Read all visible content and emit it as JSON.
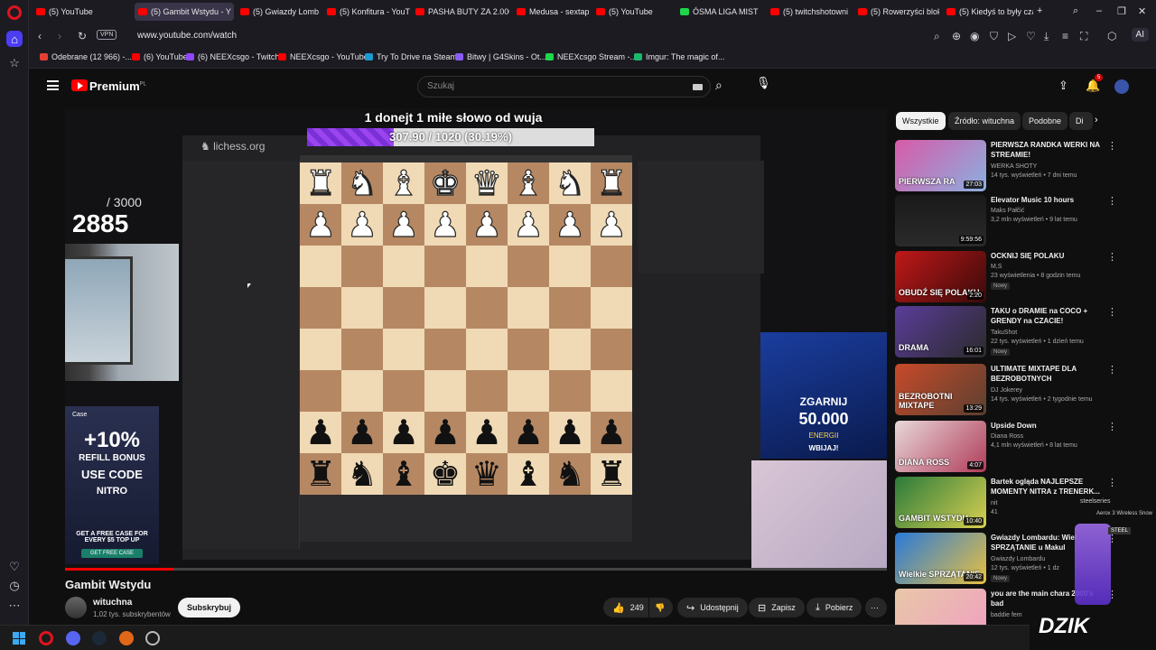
{
  "browser": {
    "tabs": [
      {
        "title": "(5) YouTube",
        "fav_color": "#ff0000",
        "active": false
      },
      {
        "title": "(5) Gambit Wstydu - Y",
        "fav_color": "#ff0000",
        "active": true
      },
      {
        "title": "(5) Gwiazdy Lomb",
        "fav_color": "#ff0000",
        "active": false
      },
      {
        "title": "(5) Konfitura - YouTub",
        "fav_color": "#ff0000",
        "active": false
      },
      {
        "title": "PASHA BUTY ZA 2.000",
        "fav_color": "#ff0000",
        "active": false
      },
      {
        "title": "Medusa - sextape (pr",
        "fav_color": "#ff0000",
        "active": false
      },
      {
        "title": "(5) YouTube",
        "fav_color": "#ff0000",
        "active": false
      },
      {
        "title": "ÓSMA LIGA MIST",
        "fav_color": "#1fd64a",
        "active": false
      },
      {
        "title": "(5) twitchshotowni",
        "fav_color": "#ff0000",
        "active": false
      },
      {
        "title": "(5) Rowerzyści blokuj",
        "fav_color": "#ff0000",
        "active": false
      },
      {
        "title": "(5) Kiedyś to były czas",
        "fav_color": "#ff0000",
        "active": false
      }
    ],
    "vpn_label": "VPN",
    "url": "www.youtube.com/watch",
    "ai_label": "AI",
    "bookmarks": [
      {
        "label": "Odebrane (12 966) -...",
        "color": "#e44133"
      },
      {
        "label": "(6) YouTube",
        "color": "#ff0000"
      },
      {
        "label": "(6) NEEXcsgo - Twitch",
        "color": "#9146ff"
      },
      {
        "label": "NEEXcsgo - YouTube",
        "color": "#ff0000"
      },
      {
        "label": "Try To Drive na Steam",
        "color": "#1b9bd1"
      },
      {
        "label": "Bitwy | G4Skins - Ot...",
        "color": "#8a5cf6"
      },
      {
        "label": "NEEXcsgo Stream -...",
        "color": "#1fd64a"
      },
      {
        "label": "Imgur: The magic of...",
        "color": "#1bb76e"
      }
    ]
  },
  "youtube": {
    "brand": "Premium",
    "country": "PL",
    "search_placeholder": "Szukaj",
    "notif_count": "5"
  },
  "video": {
    "overlay_title": "1 donejt 1 miłe słowo od wuja",
    "progress_text": "307.90 / 1020 (30.19%)",
    "progress_fraction": 0.3019,
    "counter_max": "/ 3000",
    "counter_value": "2885",
    "lichess_logo": "lichess.org",
    "ad_energy": {
      "line1": "ZGARNIJ",
      "line2": "50.000",
      "line3": "ENERGII",
      "cta": "WBIJAJ!"
    },
    "ad_case": {
      "brand": "Case",
      "bonus": "+10%",
      "line2": "REFILL BONUS",
      "line3": "USE CODE",
      "code": "NITRO",
      "offer": "GET A FREE CASE FOR EVERY $5 TOP UP",
      "cta": "GET FREE CASE"
    },
    "board": [
      [
        "r",
        "n",
        "b",
        "k",
        "q",
        "b",
        "n",
        "r"
      ],
      [
        "p",
        "p",
        "p",
        "p",
        "p",
        "p",
        "p",
        "p"
      ],
      [
        "",
        "",
        "",
        "",
        "",
        "",
        "",
        ""
      ],
      [
        "",
        "",
        "",
        "",
        "",
        "",
        "",
        ""
      ],
      [
        "",
        "",
        "",
        "",
        "",
        "",
        "",
        ""
      ],
      [
        "",
        "",
        "",
        "",
        "",
        "",
        "",
        ""
      ],
      [
        "P",
        "P",
        "P",
        "P",
        "P",
        "P",
        "P",
        "P"
      ],
      [
        "R",
        "N",
        "B",
        "K",
        "Q",
        "B",
        "N",
        "R"
      ]
    ]
  },
  "meta": {
    "title": "Gambit Wstydu",
    "channel": "wituchna",
    "subs": "1,02 tys. subskrybentów",
    "subscribe_label": "Subskrybuj",
    "likes": "249",
    "share_label": "Udostępnij",
    "save_label": "Zapisz",
    "download_label": "Pobierz"
  },
  "chips": [
    {
      "label": "Wszystkie",
      "selected": true
    },
    {
      "label": "Źródło: wituchna",
      "selected": false
    },
    {
      "label": "Podobne",
      "selected": false
    },
    {
      "label": "Di",
      "selected": false
    }
  ],
  "recommendations": [
    {
      "title": "PIERWSZA RANDKA WERKI NA STREAMIE!",
      "channel": "WERKA SHOTY",
      "meta": "14 tys. wyświetleń • 7 dni temu",
      "duration": "27:03",
      "thumb_text": "PIERWSZA RA",
      "thumb_bg": "linear-gradient(135deg,#d85aa8,#8ab0e0)",
      "new": ""
    },
    {
      "title": "Elevator Music 10 hours",
      "channel": "Maks Pałčić",
      "meta": "3,2 mln wyświetleń • 9 lat temu",
      "duration": "9:59:56",
      "thumb_text": "",
      "thumb_bg": "linear-gradient(#1a1a1a,#2a2a2a)",
      "new": ""
    },
    {
      "title": "OCKNIJ SIĘ POLAKU",
      "channel": "M,S",
      "meta": "23 wyświetlenia • 8 godzin temu",
      "duration": "2:20",
      "thumb_text": "OBUDŹ SIĘ POLAKU",
      "thumb_bg": "linear-gradient(135deg,#c01818,#3a0a0a)",
      "new": "Nowy"
    },
    {
      "title": "TAKU o DRAMIE na COCO + GRENDY na CZACIE!",
      "channel": "TakuShot",
      "meta": "22 tys. wyświetleń • 1 dzień temu",
      "duration": "16:01",
      "thumb_text": "DRAMA",
      "thumb_bg": "linear-gradient(135deg,#5a3c9a,#2b2b2b)",
      "new": "Nowy"
    },
    {
      "title": "ULTIMATE MIXTAPE DLA BEZROBOTNYCH",
      "channel": "DJ Jokerey",
      "meta": "14 tys. wyświetleń • 2 tygodnie temu",
      "duration": "13:29",
      "thumb_text": "BEZROBOTNI MIXTAPE",
      "thumb_bg": "linear-gradient(135deg,#c84a2a,#5a4030)",
      "new": ""
    },
    {
      "title": "Upside Down",
      "channel": "Diana Ross",
      "meta": "4,1 mln wyświetleń • 8 lat temu",
      "duration": "4:07",
      "thumb_text": "DIANA ROSS",
      "thumb_bg": "linear-gradient(135deg,#e8d8d8,#b03c5a)",
      "new": ""
    },
    {
      "title": "Bartek ogląda NAJLEPSZE MOMENTY NITRA z TRENERK...",
      "channel": "nit",
      "meta": "41",
      "duration": "10:40",
      "thumb_text": "GAMBIT WSTYDU",
      "thumb_bg": "linear-gradient(135deg,#2a7a3a,#d8d050)",
      "new": ""
    },
    {
      "title": "Gwiazdy Lombardu: Wiel SPRZĄTANIE u Makul",
      "channel": "Gwiazdy Lombardu",
      "meta": "12 tys. wyświetleń • 1 dz",
      "duration": "20:42",
      "thumb_text": "Wielkie SPRZĄTANIE",
      "thumb_bg": "linear-gradient(135deg,#2a7ad8,#e8c040)",
      "new": "Nowy"
    },
    {
      "title": "you are the main chara 2000's bad",
      "channel": "baddie fem",
      "meta": "",
      "duration": "",
      "thumb_text": "",
      "thumb_bg": "linear-gradient(135deg,#e8c8a8,#f0a0c0)",
      "new": ""
    }
  ],
  "steelseries": {
    "brand": "steelseries",
    "product": "Aerox 3 Wireless Snow",
    "tag": "STEEL"
  },
  "watermark": "DZIK"
}
